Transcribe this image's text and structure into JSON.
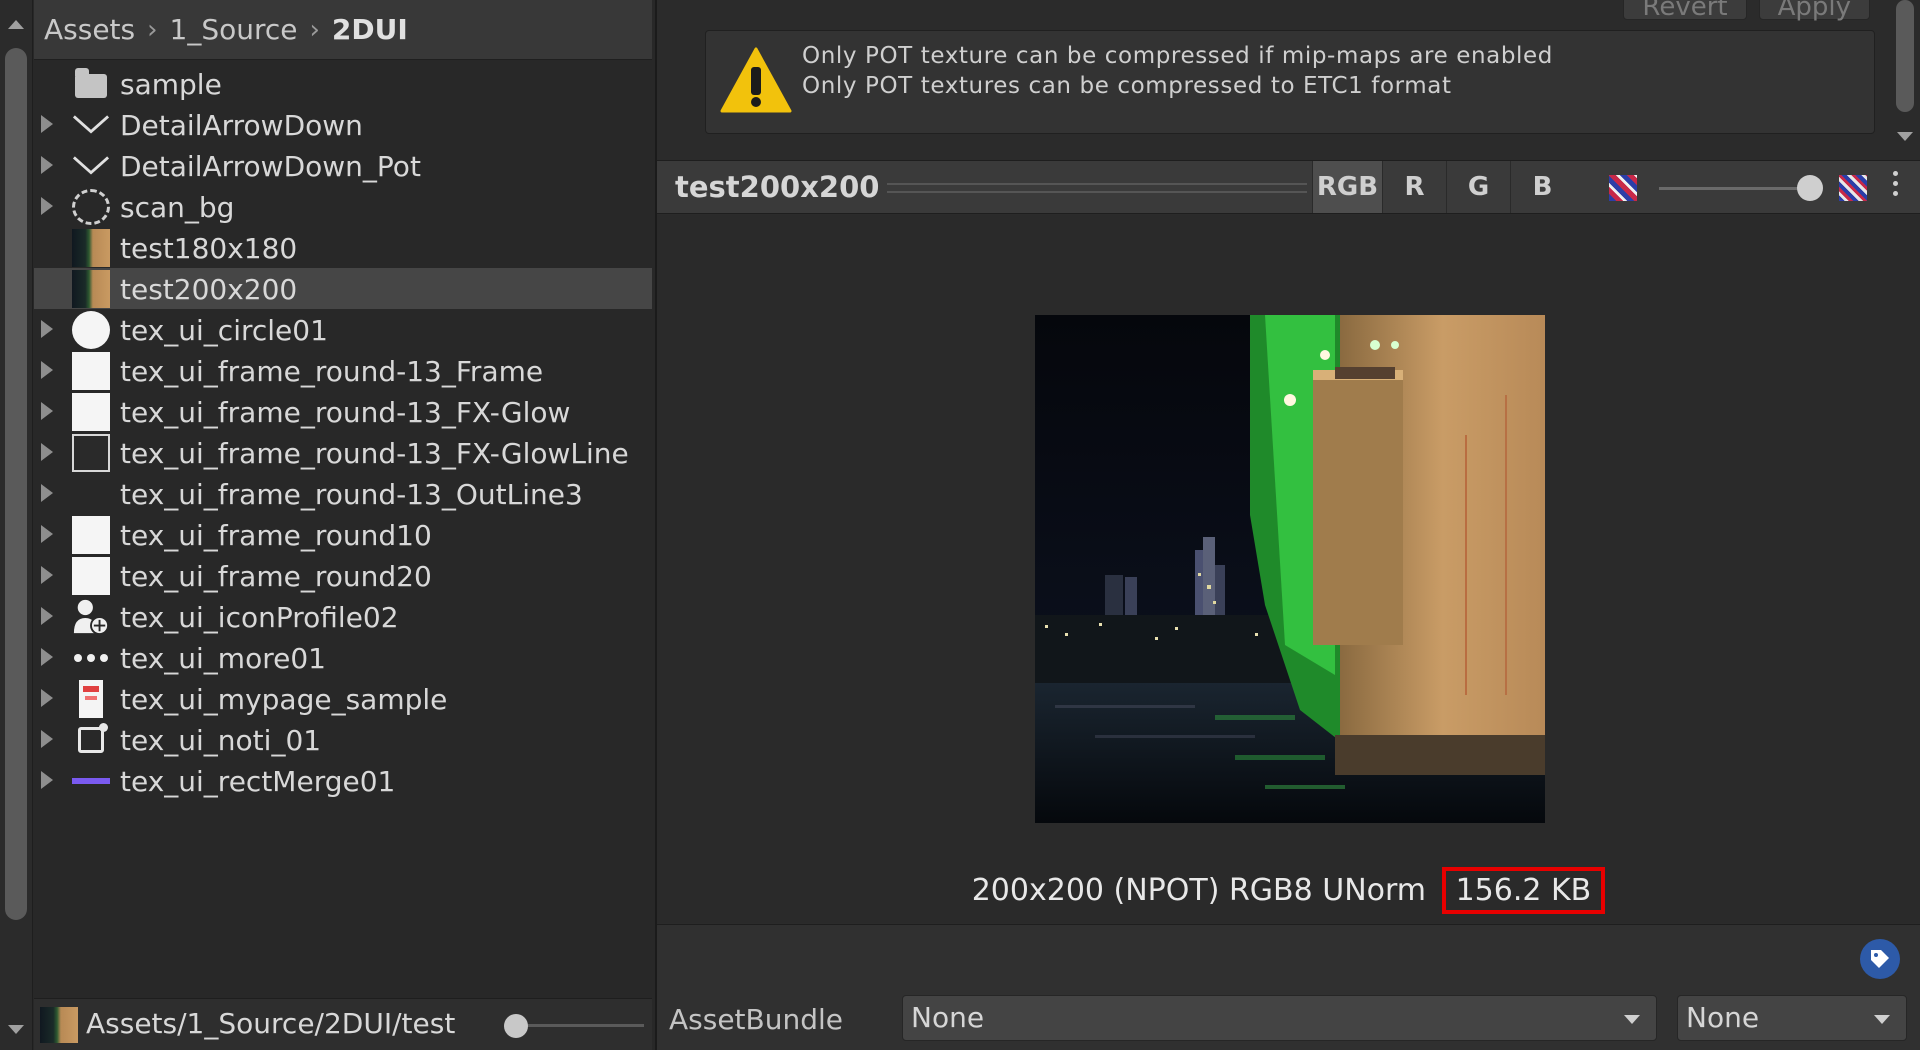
{
  "breadcrumb": [
    "Assets",
    "1_Source",
    "2DUI"
  ],
  "tree": [
    {
      "label": "sample",
      "icon": "folder-icon",
      "expandable": false,
      "selected": false
    },
    {
      "label": "DetailArrowDown",
      "icon": "chevron-down-icon",
      "expandable": true,
      "selected": false
    },
    {
      "label": "DetailArrowDown_Pot",
      "icon": "chevron-down-icon",
      "expandable": true,
      "selected": false
    },
    {
      "label": "scan_bg",
      "icon": "dashed-circle-icon",
      "expandable": true,
      "selected": false
    },
    {
      "label": "test180x180",
      "icon": "photo-thumbnail-icon",
      "expandable": false,
      "selected": false
    },
    {
      "label": "test200x200",
      "icon": "photo-thumbnail-icon",
      "expandable": false,
      "selected": true
    },
    {
      "label": "tex_ui_circle01",
      "icon": "white-circle-icon",
      "expandable": true,
      "selected": false
    },
    {
      "label": "tex_ui_frame_round-13_Frame",
      "icon": "white-square-icon",
      "expandable": true,
      "selected": false
    },
    {
      "label": "tex_ui_frame_round-13_FX-Glow",
      "icon": "white-square-icon",
      "expandable": true,
      "selected": false
    },
    {
      "label": "tex_ui_frame_round-13_FX-GlowLine",
      "icon": "outline-square-icon",
      "expandable": true,
      "selected": false
    },
    {
      "label": "tex_ui_frame_round-13_OutLine3",
      "icon": "blank-icon",
      "expandable": true,
      "selected": false
    },
    {
      "label": "tex_ui_frame_round10",
      "icon": "white-square-icon",
      "expandable": true,
      "selected": false
    },
    {
      "label": "tex_ui_frame_round20",
      "icon": "white-square-icon",
      "expandable": true,
      "selected": false
    },
    {
      "label": "tex_ui_iconProfile02",
      "icon": "profile-icon",
      "expandable": true,
      "selected": false
    },
    {
      "label": "tex_ui_more01",
      "icon": "more-dots-icon",
      "expandable": true,
      "selected": false
    },
    {
      "label": "tex_ui_mypage_sample",
      "icon": "mypage-icon",
      "expandable": true,
      "selected": false
    },
    {
      "label": "tex_ui_noti_01",
      "icon": "notification-icon",
      "expandable": true,
      "selected": false
    },
    {
      "label": "tex_ui_rectMerge01",
      "icon": "purple-line-icon",
      "expandable": true,
      "selected": false
    }
  ],
  "footer": {
    "path": "Assets/1_Source/2DUI/test"
  },
  "top_buttons": {
    "revert": "Revert",
    "apply": "Apply"
  },
  "warning": {
    "line1": "Only POT texture can be compressed if mip-maps are enabled",
    "line2": "Only POT textures can be compressed to ETC1 format"
  },
  "preview": {
    "title": "test200x200",
    "channels": [
      "RGB",
      "R",
      "G",
      "B"
    ],
    "active_channel": "RGB",
    "info_main": "200x200 (NPOT)  RGB8 UNorm",
    "info_size": "156.2 KB"
  },
  "assetbundle": {
    "label": "AssetBundle",
    "name": "None",
    "variant": "None"
  },
  "colors": {
    "highlight": "#e80000",
    "selection": "#464646",
    "accent": "#2d5aa8"
  }
}
